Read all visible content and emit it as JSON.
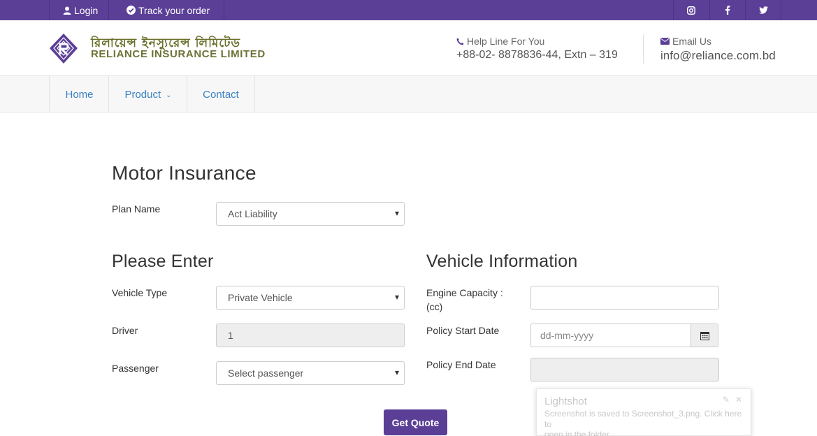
{
  "topbar": {
    "login_label": "Login",
    "track_label": "Track your order",
    "social": [
      "instagram-icon",
      "facebook-icon",
      "twitter-icon"
    ]
  },
  "header": {
    "brand_bengali": "রিলায়েন্স ইনস্যুরেন্স লিমিটেড",
    "brand_english": "RELIANCE INSURANCE LIMITED",
    "help_label": "Help Line For You",
    "help_value": "+88-02- 8878836-44, Extn – 319",
    "email_label": "Email Us",
    "email_value": "info@reliance.com.bd"
  },
  "nav": {
    "items": [
      {
        "label": "Home"
      },
      {
        "label": "Product",
        "has_dropdown": true
      },
      {
        "label": "Contact"
      }
    ]
  },
  "form": {
    "title": "Motor Insurance",
    "plan_name_label": "Plan Name",
    "plan_name_value": "Act Liability",
    "left_section_title": "Please Enter",
    "vehicle_type_label": "Vehicle Type",
    "vehicle_type_value": "Private Vehicle",
    "driver_label": "Driver",
    "driver_value": "1",
    "passenger_label": "Passenger",
    "passenger_value": "Select passenger",
    "right_section_title": "Vehicle Information",
    "engine_capacity_label_1": "Engine Capacity :",
    "engine_capacity_label_2": "(cc)",
    "engine_capacity_value": "",
    "policy_start_label": "Policy Start Date",
    "policy_start_placeholder": "dd-mm-yyyy",
    "policy_end_label": "Policy End Date",
    "policy_end_value": "",
    "submit_label": "Get Quote"
  },
  "toast": {
    "title": "Lightshot",
    "message_line1": "Screenshot is saved to Screenshot_3.png. Click here to",
    "message_line2": "open in the folder."
  },
  "colors": {
    "brand_purple": "#5b3f97",
    "link_blue": "#3a7fc4",
    "logo_olive": "#6e7236"
  }
}
